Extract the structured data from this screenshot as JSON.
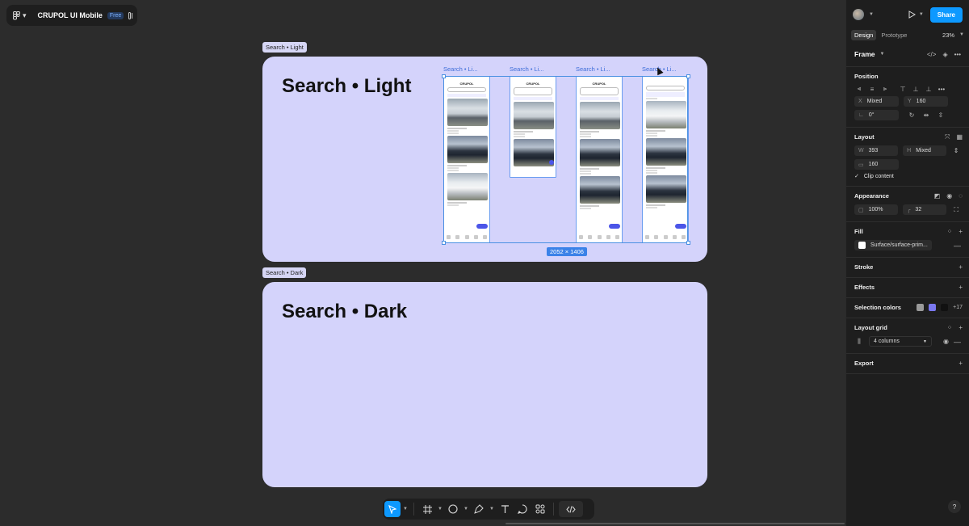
{
  "app": {
    "project_name": "CRUPOL UI Mobile",
    "plan_badge": "Free"
  },
  "canvas": {
    "frames": [
      {
        "tag": "Search • Light",
        "title": "Search • Light"
      },
      {
        "tag": "Search • Dark",
        "title": "Search • Dark"
      }
    ],
    "phone_labels": [
      "Search • Li...",
      "Search • Li...",
      "Search • Li...",
      "Search • Li..."
    ],
    "selection_size": "2052 × 1406"
  },
  "panel": {
    "share_label": "Share",
    "tabs": [
      "Design",
      "Prototype"
    ],
    "zoom": "23%",
    "frame_type": "Frame",
    "position": {
      "title": "Position",
      "x_label": "X",
      "x_value": "Mixed",
      "y_label": "Y",
      "y_value": "160",
      "rotation": "0°"
    },
    "layout": {
      "title": "Layout",
      "w_label": "W",
      "w_value": "393",
      "h_label": "H",
      "h_value": "Mixed",
      "gap_value": "160",
      "clip_label": "Clip content"
    },
    "appearance": {
      "title": "Appearance",
      "opacity": "100%",
      "radius": "32"
    },
    "fill": {
      "title": "Fill",
      "value": "Surface/surface-prim..."
    },
    "stroke": {
      "title": "Stroke"
    },
    "effects": {
      "title": "Effects"
    },
    "selection_colors": {
      "title": "Selection colors",
      "more": "+17",
      "colors": [
        "#9a9a9a",
        "#7a78f0",
        "#111111"
      ]
    },
    "layout_grid": {
      "title": "Layout grid",
      "value": "4 columns"
    },
    "export": {
      "title": "Export"
    },
    "help": "?"
  },
  "icons": [
    "figma-menu-icon",
    "sidebar-toggle-icon",
    "move-tool-icon",
    "frame-tool-icon",
    "ellipse-tool-icon",
    "pen-tool-icon",
    "text-tool-icon",
    "comment-tool-icon",
    "components-tool-icon",
    "dev-mode-icon",
    "play-icon",
    "plus-icon",
    "minus-icon",
    "eye-icon"
  ]
}
